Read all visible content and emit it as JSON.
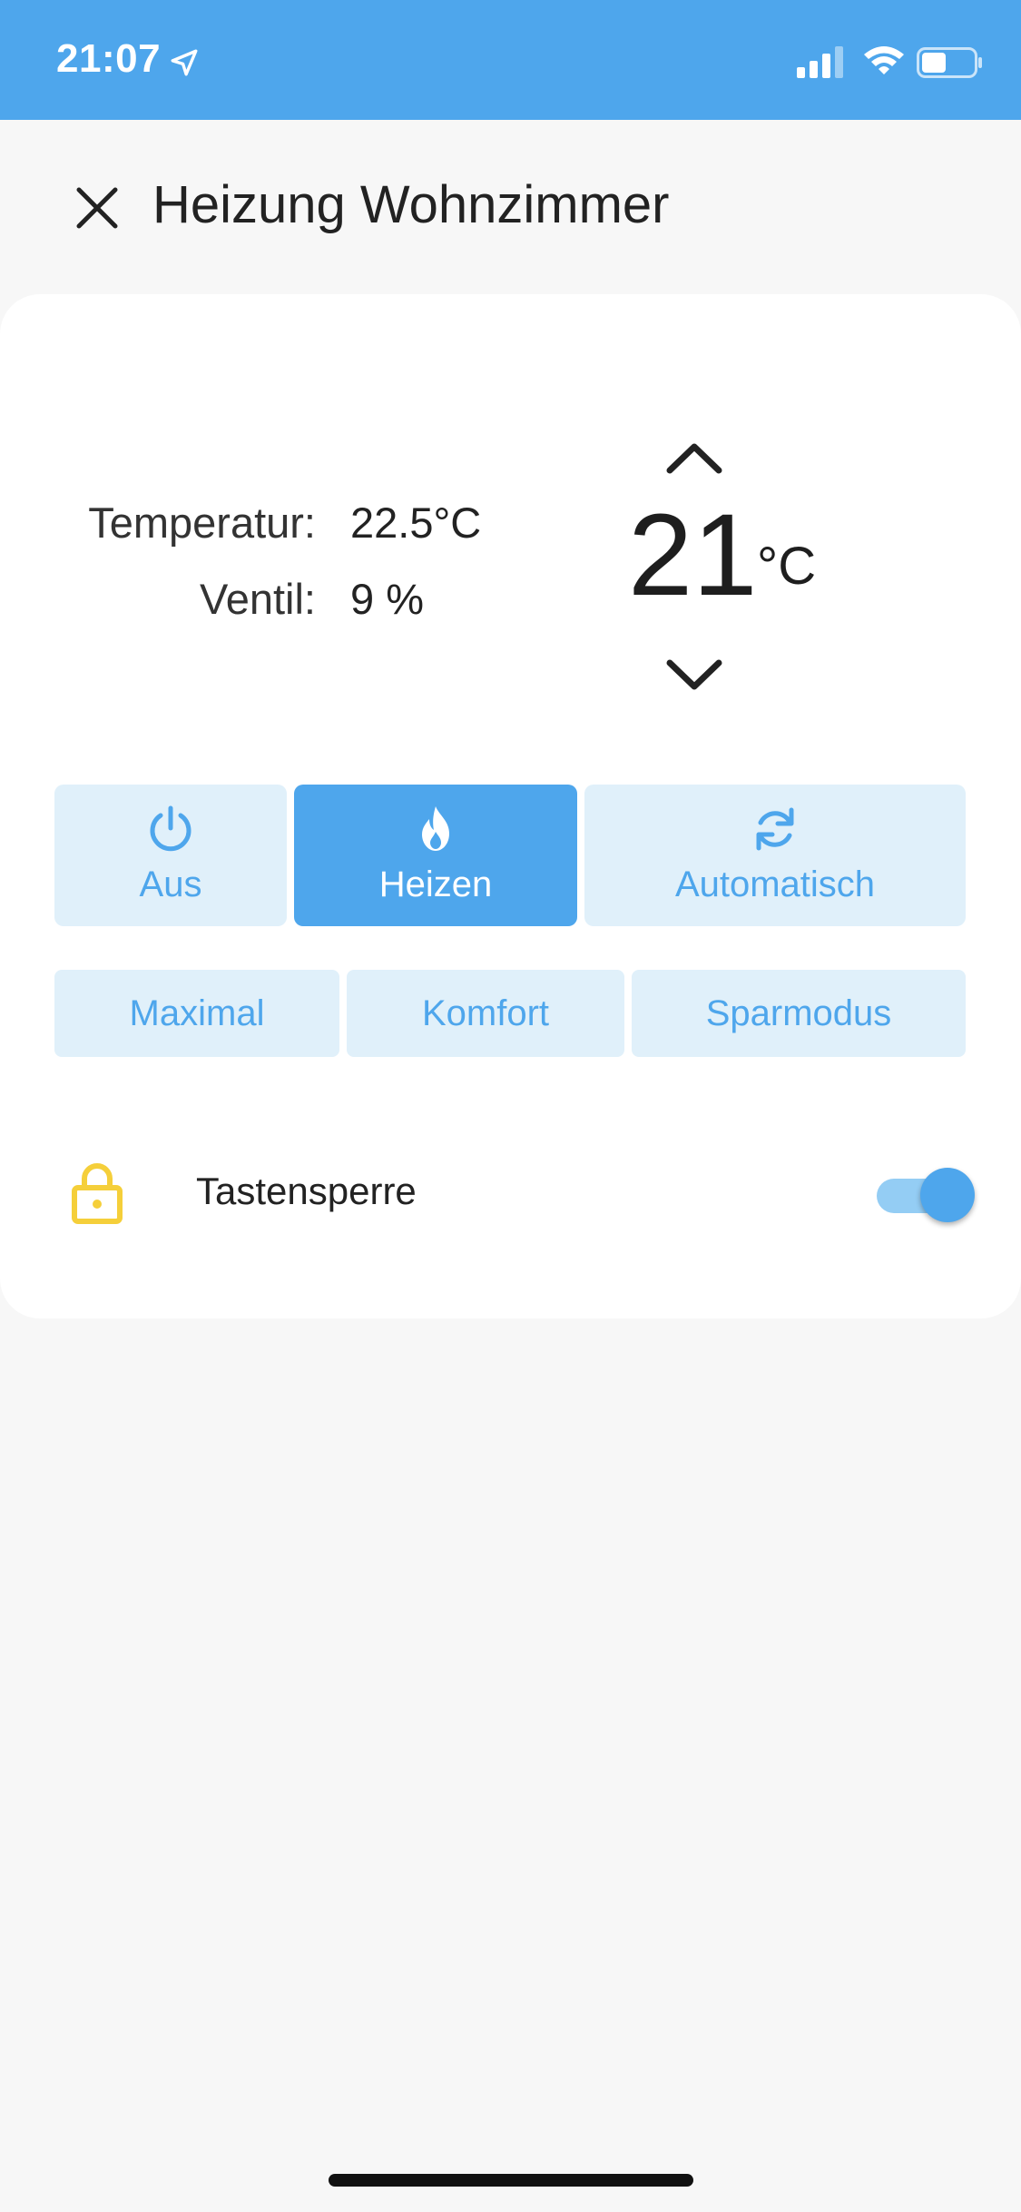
{
  "status_bar": {
    "time": "21:07"
  },
  "header": {
    "title": "Heizung Wohnzimmer"
  },
  "info": {
    "temperature_label": "Temperatur:",
    "temperature_value": "22.5°C",
    "valve_label": "Ventil:",
    "valve_value": "9 %"
  },
  "setpoint": {
    "value": "21",
    "unit": "°C"
  },
  "modes": [
    {
      "label": "Aus",
      "icon": "power-icon",
      "active": false
    },
    {
      "label": "Heizen",
      "icon": "flame-icon",
      "active": true
    },
    {
      "label": "Automatisch",
      "icon": "sync-icon",
      "active": false
    }
  ],
  "presets": [
    {
      "label": "Maximal"
    },
    {
      "label": "Komfort"
    },
    {
      "label": "Sparmodus"
    }
  ],
  "key_lock": {
    "label": "Tastensperre",
    "enabled": true,
    "icon": "lock-icon"
  },
  "colors": {
    "accent": "#4ea6ec",
    "accent_light": "#e0f0fa",
    "lock_icon": "#f5cf3a"
  }
}
